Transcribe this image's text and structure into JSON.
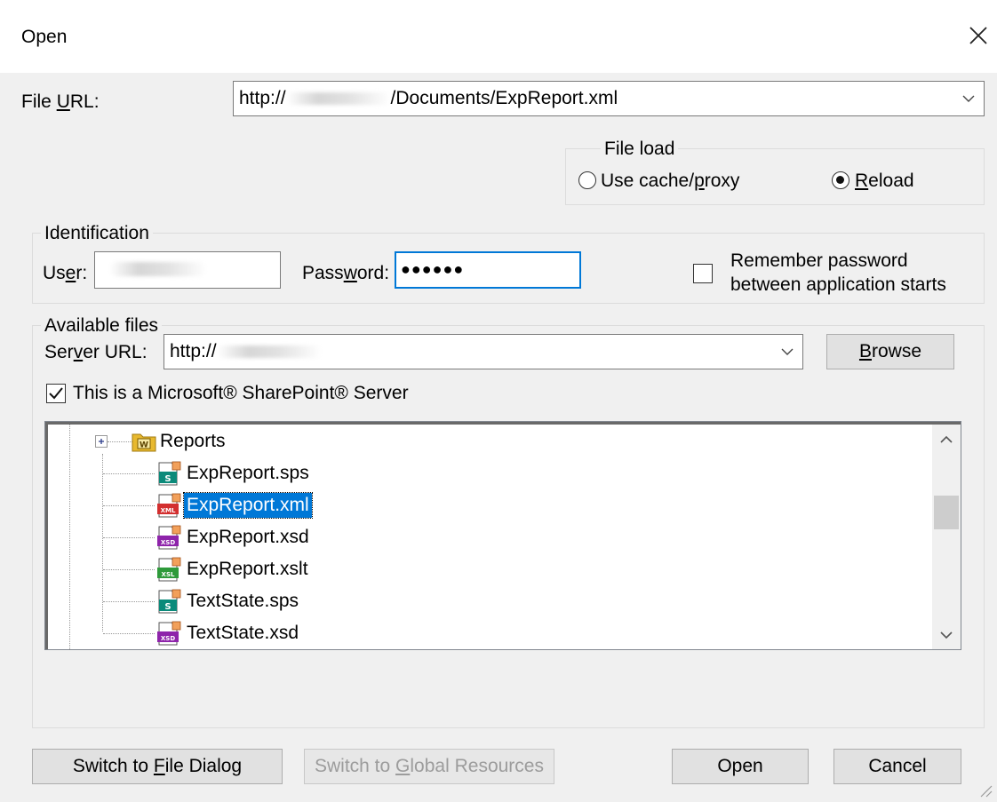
{
  "dialog": {
    "title": "Open"
  },
  "file_url": {
    "label_pre": "File ",
    "label_u": "U",
    "label_post": "RL:",
    "value_prefix": "http://",
    "value_suffix": "/Documents/ExpReport.xml"
  },
  "file_load": {
    "legend": "File load",
    "options": [
      {
        "pre": "Use cache/",
        "u": "p",
        "post": "roxy",
        "selected": false
      },
      {
        "pre": "",
        "u": "R",
        "post": "eload",
        "selected": true
      }
    ]
  },
  "identification": {
    "legend": "Identification",
    "user_label_pre": "Us",
    "user_label_u": "e",
    "user_label_post": "r:",
    "password_label_pre": "Pass",
    "password_label_u": "w",
    "password_label_post": "ord:",
    "password_mask": "●●●●●●",
    "remember_line1": "Remember password",
    "remember_line2": "between application starts",
    "remember_checked": false
  },
  "available_files": {
    "legend": "Available files",
    "server_label_pre": "Ser",
    "server_label_u": "v",
    "server_label_post": "er URL:",
    "server_value_prefix": "http://",
    "browse_pre": "",
    "browse_u": "B",
    "browse_post": "rowse",
    "sharepoint_label": "This is a Microsoft® SharePoint® Server",
    "sharepoint_checked": true,
    "tree_items": [
      {
        "name": "Reports",
        "icon": "folder-w-icon",
        "selected": false
      },
      {
        "name": "ExpReport.sps",
        "icon": "sps-file-icon",
        "selected": false
      },
      {
        "name": "ExpReport.xml",
        "icon": "xml-file-icon",
        "selected": true
      },
      {
        "name": "ExpReport.xsd",
        "icon": "xsd-file-icon",
        "selected": false
      },
      {
        "name": "ExpReport.xslt",
        "icon": "xslt-file-icon",
        "selected": false
      },
      {
        "name": "TextState.sps",
        "icon": "sps-file-icon",
        "selected": false
      },
      {
        "name": "TextState.xsd",
        "icon": "xsd-file-icon",
        "selected": false
      }
    ]
  },
  "buttons": {
    "switch_file_pre": "Switch to ",
    "switch_file_u": "F",
    "switch_file_post": "ile Dialog",
    "switch_global_pre": "Switch to ",
    "switch_global_u": "G",
    "switch_global_post": "lobal Resources",
    "open": "Open",
    "cancel": "Cancel"
  },
  "colors": {
    "selection": "#0078d7",
    "dialog_bg": "#f0f0f0",
    "sps_icon": "#0b8a7a",
    "xml_icon": "#d32f2f",
    "xsd_icon": "#8e24aa",
    "xslt_icon": "#2e9a3a",
    "folder_icon": "#e8b92f"
  }
}
